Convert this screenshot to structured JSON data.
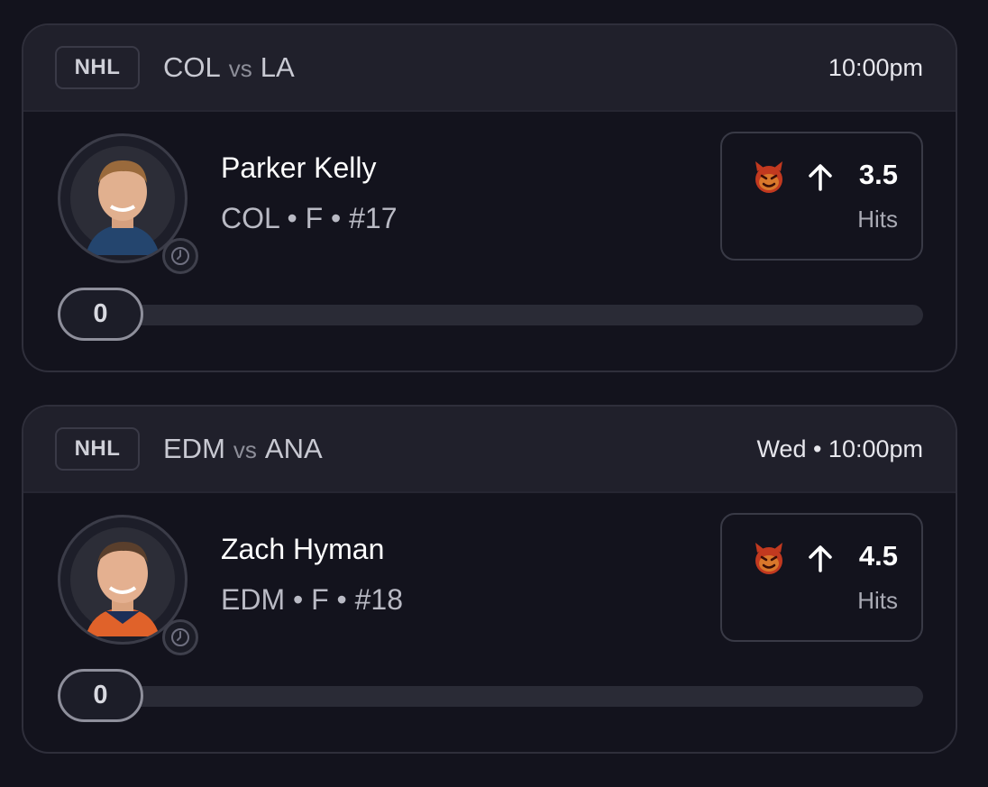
{
  "cards": [
    {
      "league": "NHL",
      "home_team": "COL",
      "vs_label": "vs",
      "away_team": "LA",
      "game_time": "10:00pm",
      "player": {
        "name": "Parker Kelly",
        "meta": "COL • F • #17"
      },
      "pick": {
        "icon": "devil-icon",
        "direction": "up",
        "line": "3.5",
        "stat": "Hits"
      },
      "progress": {
        "current": "0",
        "fraction": 0
      }
    },
    {
      "league": "NHL",
      "home_team": "EDM",
      "vs_label": "vs",
      "away_team": "ANA",
      "game_time": "Wed • 10:00pm",
      "player": {
        "name": "Zach Hyman",
        "meta": "EDM • F • #18"
      },
      "pick": {
        "icon": "devil-icon",
        "direction": "up",
        "line": "4.5",
        "stat": "Hits"
      },
      "progress": {
        "current": "0",
        "fraction": 0
      }
    }
  ],
  "colors": {
    "background": "#13131d",
    "header": "#20202b",
    "devil": "#c2391f"
  }
}
